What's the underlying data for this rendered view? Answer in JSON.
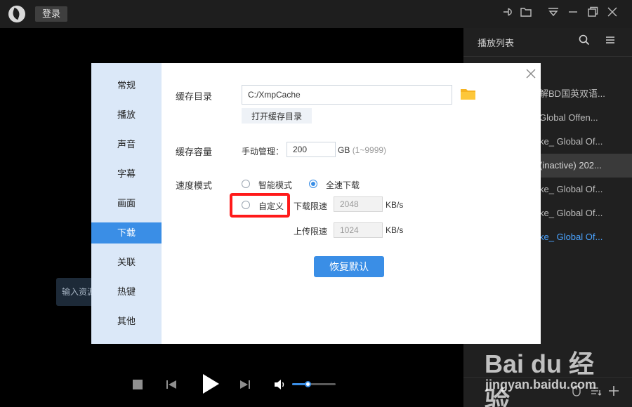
{
  "titlebar": {
    "login_label": "登录",
    "icons": [
      "pin-icon",
      "folder-icon",
      "menu-down-icon",
      "minimize-icon",
      "restore-icon",
      "close-icon"
    ]
  },
  "sidebar": {
    "title": "播放列表",
    "items": [
      {
        "label": "解BD国英双语..."
      },
      {
        "label": "Global Offen..."
      },
      {
        "label": "ke_ Global Of..."
      },
      {
        "label": "(inactive) 202..."
      },
      {
        "label": "ke_ Global Of..."
      },
      {
        "label": "ke_ Global Of..."
      },
      {
        "label": "ke_ Global Of..."
      }
    ],
    "selected_index": 3,
    "playing_index": 6
  },
  "url_input": {
    "placeholder": "输入资源"
  },
  "player": {
    "volume": 0.35
  },
  "dialog": {
    "nav": [
      "常规",
      "播放",
      "声音",
      "字幕",
      "画面",
      "下载",
      "关联",
      "热键",
      "其他"
    ],
    "active_index": 5,
    "cache_dir": {
      "label": "缓存目录",
      "value": "C:/XmpCache",
      "open_button": "打开缓存目录"
    },
    "cache_size": {
      "label": "缓存容量",
      "manual_label": "手动管理：",
      "value": "200",
      "unit": "GB",
      "range": "(1~9999)"
    },
    "speed_mode": {
      "label": "速度模式",
      "options": [
        "智能模式",
        "全速下载",
        "自定义"
      ],
      "selected": "全速下载",
      "download_limit_label": "下载限速",
      "download_limit": "2048",
      "upload_limit_label": "上传限速",
      "upload_limit": "1024",
      "unit": "KB/s"
    },
    "restore_button": "恢复默认"
  },
  "watermark": {
    "brand": "Bai du 经验",
    "url": "jingyan.baidu.com"
  },
  "colors": {
    "accent": "#3a8ee6",
    "highlight": "#ff1a1a",
    "nav_bg": "#dbe8f8"
  }
}
